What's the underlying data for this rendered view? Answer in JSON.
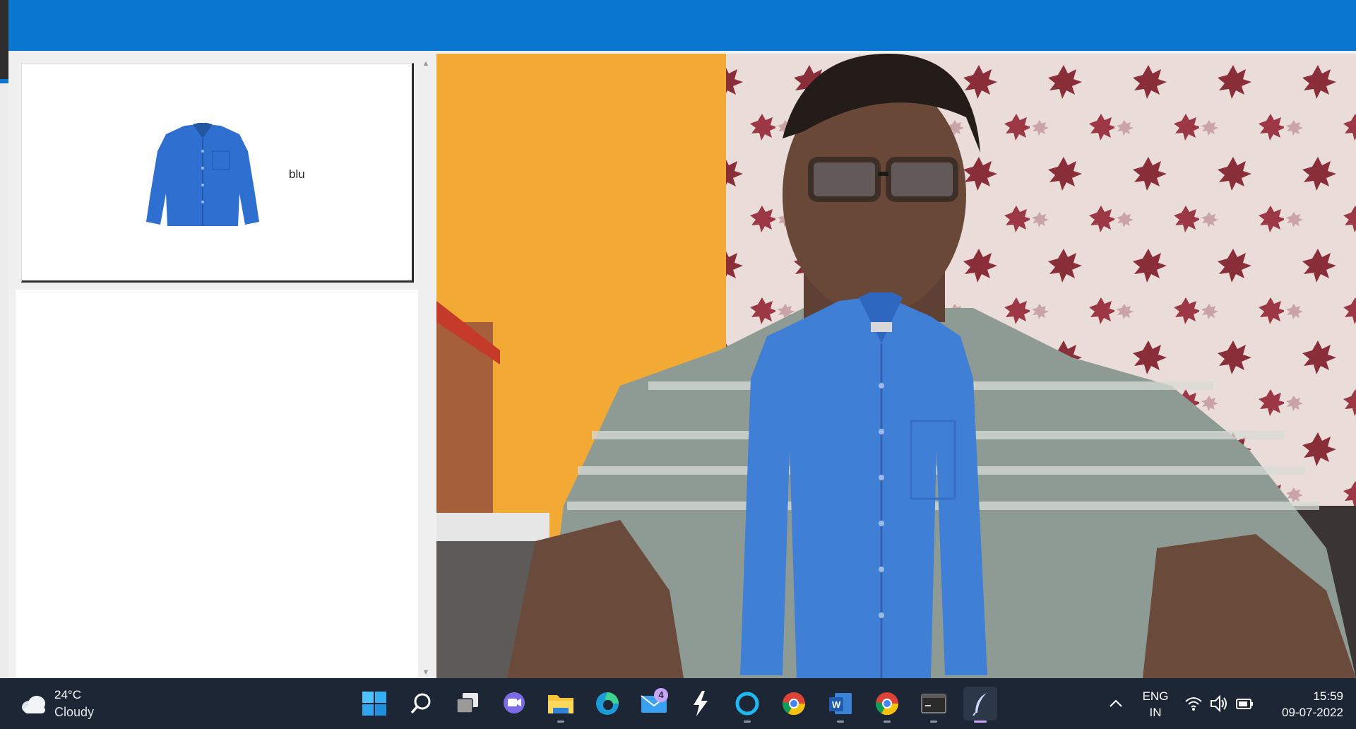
{
  "window": {
    "title": ""
  },
  "catalog": {
    "items": [
      {
        "label": "blu",
        "color": "#2f6fd0"
      }
    ]
  },
  "camera_view": {
    "description_colors": {
      "wall": "#f2a62e",
      "overlay_shirt": "#3f7fd6"
    }
  },
  "taskbar": {
    "weather": {
      "temperature": "24°C",
      "condition": "Cloudy"
    },
    "pinned_apps": [
      {
        "name": "start",
        "icon": "windows-icon"
      },
      {
        "name": "search",
        "icon": "search-icon"
      },
      {
        "name": "task-view",
        "icon": "task-view-icon"
      },
      {
        "name": "teams-chat",
        "icon": "chat-icon"
      },
      {
        "name": "file-explorer",
        "icon": "folder-icon"
      },
      {
        "name": "edge",
        "icon": "edge-icon"
      },
      {
        "name": "mail",
        "icon": "mail-icon",
        "badge": "4"
      },
      {
        "name": "app",
        "icon": "lightning-icon"
      },
      {
        "name": "cortana",
        "icon": "cortana-icon"
      },
      {
        "name": "chrome",
        "icon": "chrome-icon"
      },
      {
        "name": "word",
        "icon": "word-icon"
      },
      {
        "name": "chrome-2",
        "icon": "chrome-icon"
      },
      {
        "name": "terminal",
        "icon": "terminal-icon"
      },
      {
        "name": "python",
        "icon": "feather-icon"
      }
    ],
    "tray": {
      "language_line1": "ENG",
      "language_line2": "IN",
      "time": "15:59",
      "date": "09-07-2022"
    }
  }
}
